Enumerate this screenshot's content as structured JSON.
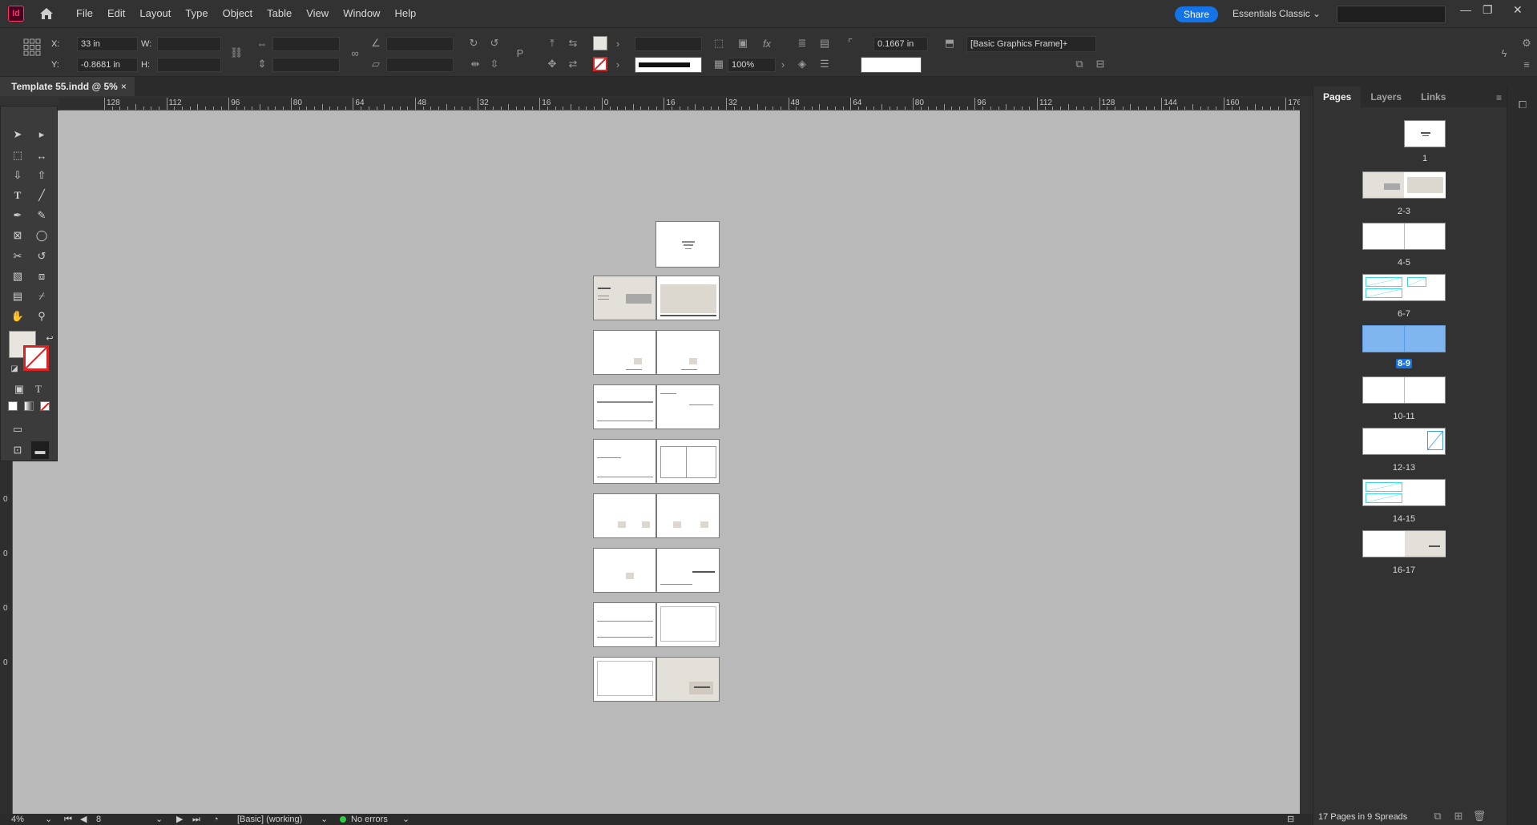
{
  "app": {
    "logo": "Id",
    "share_label": "Share",
    "workspace": "Essentials Classic"
  },
  "menu": [
    "File",
    "Edit",
    "Layout",
    "Type",
    "Object",
    "Table",
    "View",
    "Window",
    "Help"
  ],
  "control": {
    "x_label": "X:",
    "x_value": "33 in",
    "y_label": "Y:",
    "y_value": "-0.8681 in",
    "w_label": "W:",
    "h_label": "H:",
    "scale_value": "100%",
    "stroke_weight": "0.1667 in",
    "object_style": "[Basic Graphics Frame]+"
  },
  "document_tab": {
    "title": "Template 55.indd @ 5%",
    "close": "×"
  },
  "ruler_labels": [
    "128",
    "112",
    "96",
    "80",
    "64",
    "48",
    "32",
    "16",
    "0",
    "16",
    "32",
    "48",
    "64",
    "80",
    "96",
    "112",
    "128",
    "144",
    "160",
    "176"
  ],
  "vruler_labels": [
    "0",
    "0",
    "0",
    "0"
  ],
  "pages_panel": {
    "tabs": [
      "Pages",
      "Layers",
      "Links"
    ],
    "spreads": [
      {
        "label": "1"
      },
      {
        "label": "2-3"
      },
      {
        "label": "4-5"
      },
      {
        "label": "6-7"
      },
      {
        "label": "8-9",
        "selected": true
      },
      {
        "label": "10-11"
      },
      {
        "label": "12-13"
      },
      {
        "label": "14-15"
      },
      {
        "label": "16-17"
      }
    ],
    "footer": "17 Pages in 9 Spreads"
  },
  "status": {
    "zoom": "4%",
    "page": "8",
    "style": "[Basic] (working)",
    "preflight": "No errors"
  },
  "colors": {
    "accent": "#1473e6",
    "selected_spread": "#7fb6f0",
    "cyan_frame": "#3fd6e6",
    "beige": "#e3e0da",
    "ok_dot": "#2ecc40"
  }
}
